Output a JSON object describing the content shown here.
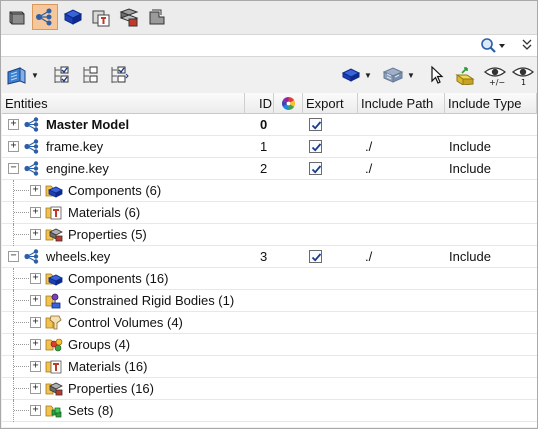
{
  "columns": {
    "entities": "Entities",
    "id": "ID",
    "export": "Export",
    "include_path": "Include Path",
    "include_type": "Include Type"
  },
  "tabs": [
    {
      "icon": "solid-box-icon",
      "active": false
    },
    {
      "icon": "model-tree-icon",
      "active": true
    },
    {
      "icon": "component-icon",
      "active": false
    },
    {
      "icon": "material-icon",
      "active": false
    },
    {
      "icon": "property-icon",
      "active": false
    },
    {
      "icon": "gray-box-icon",
      "active": false
    }
  ],
  "rows": [
    {
      "level": 0,
      "expander": "+",
      "icon": "include-tree-icon",
      "label": "Master Model",
      "bold": true,
      "id": "0",
      "export": true,
      "path": "",
      "type": ""
    },
    {
      "level": 0,
      "expander": "+",
      "icon": "include-tree-icon",
      "label": "frame.key",
      "bold": false,
      "id": "1",
      "export": true,
      "path": "./",
      "type": "Include"
    },
    {
      "level": 0,
      "expander": "-",
      "icon": "include-tree-icon",
      "label": "engine.key",
      "bold": false,
      "id": "2",
      "export": true,
      "path": "./",
      "type": "Include"
    },
    {
      "level": 1,
      "expander": "+",
      "icon": "components-icon",
      "label": "Components (6)"
    },
    {
      "level": 1,
      "expander": "+",
      "icon": "materials-icon",
      "label": "Materials (6)"
    },
    {
      "level": 1,
      "expander": "+",
      "icon": "properties-icon",
      "label": "Properties (5)"
    },
    {
      "level": 0,
      "expander": "-",
      "icon": "include-tree-icon",
      "label": "wheels.key",
      "bold": false,
      "id": "3",
      "export": true,
      "path": "./",
      "type": "Include"
    },
    {
      "level": 1,
      "expander": "+",
      "icon": "components-icon",
      "label": "Components (16)"
    },
    {
      "level": 1,
      "expander": "+",
      "icon": "rigid-bodies-icon",
      "label": "Constrained Rigid Bodies (1)"
    },
    {
      "level": 1,
      "expander": "+",
      "icon": "control-volumes-icon",
      "label": "Control Volumes (4)"
    },
    {
      "level": 1,
      "expander": "+",
      "icon": "groups-icon",
      "label": "Groups (4)"
    },
    {
      "level": 1,
      "expander": "+",
      "icon": "materials-icon",
      "label": "Materials (16)"
    },
    {
      "level": 1,
      "expander": "+",
      "icon": "properties-icon",
      "label": "Properties (16)"
    },
    {
      "level": 1,
      "expander": "+",
      "icon": "sets-icon",
      "label": "Sets (8)"
    }
  ]
}
